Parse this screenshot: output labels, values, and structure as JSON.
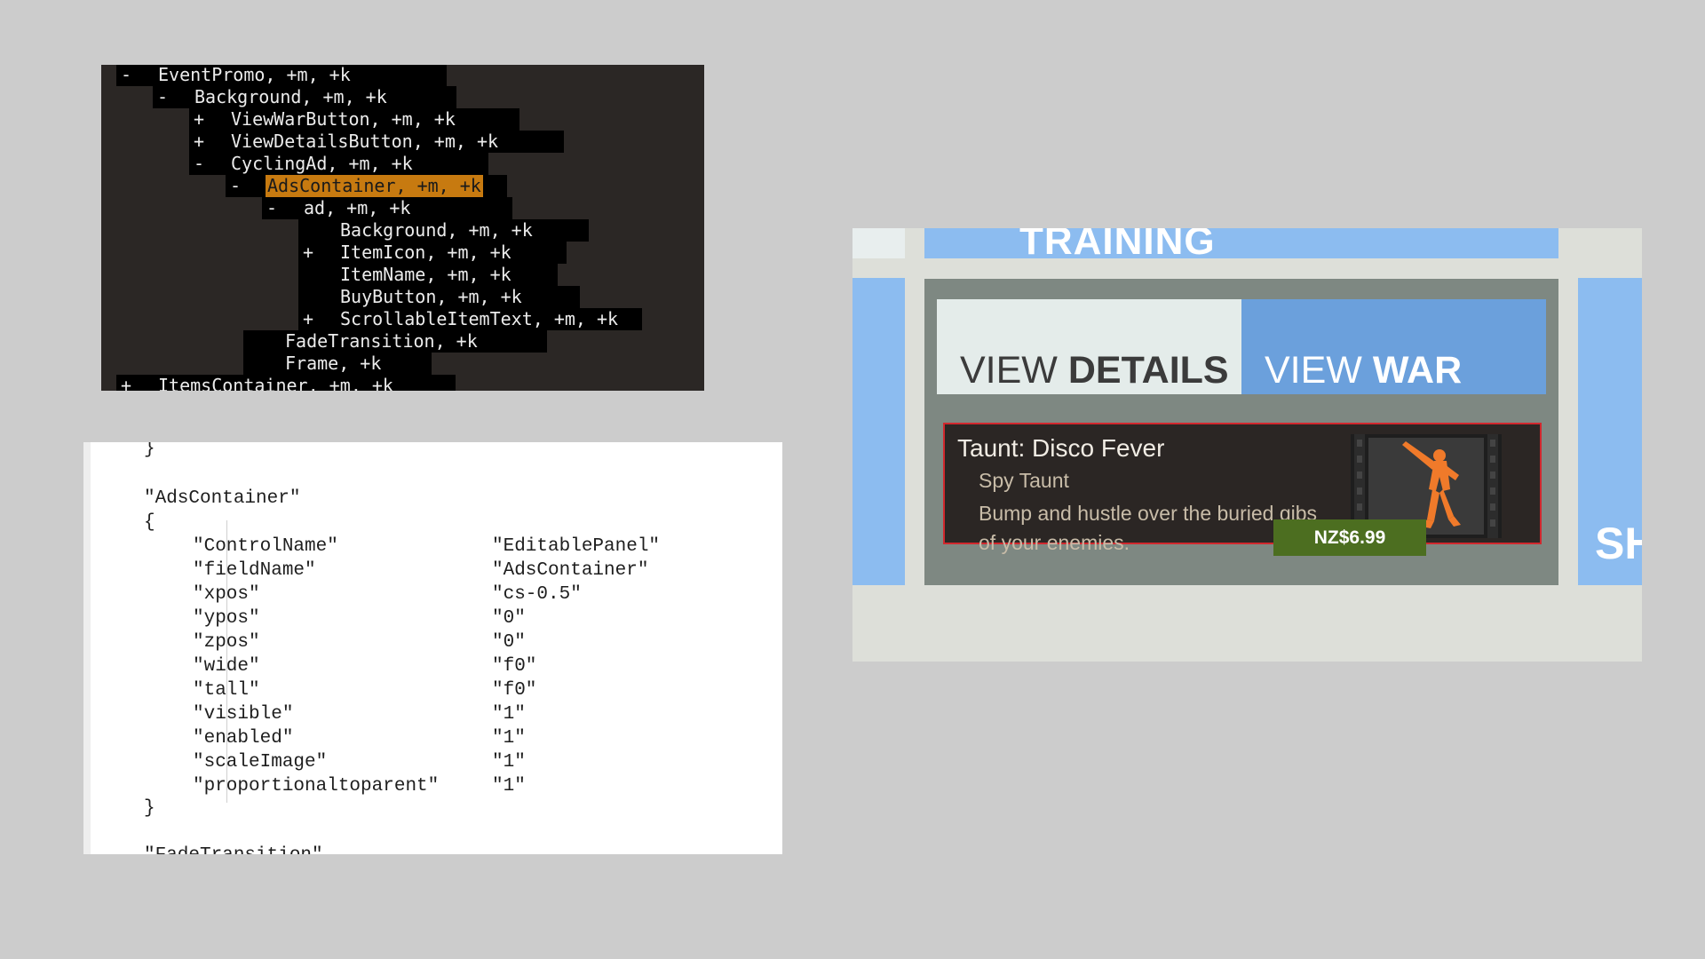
{
  "tree": {
    "rows": [
      {
        "sign": "-",
        "label": "EventPromo, +m, +k"
      },
      {
        "sign": "-",
        "label": "Background, +m, +k"
      },
      {
        "sign": "+",
        "label": "ViewWarButton, +m, +k"
      },
      {
        "sign": "+",
        "label": "ViewDetailsButton, +m, +k"
      },
      {
        "sign": "-",
        "label": "CyclingAd, +m, +k"
      },
      {
        "sign": "-",
        "label": "AdsContainer, +m, +k"
      },
      {
        "sign": "-",
        "label": "ad, +m, +k"
      },
      {
        "sign": "",
        "label": "Background, +m, +k"
      },
      {
        "sign": "+",
        "label": "ItemIcon, +m, +k"
      },
      {
        "sign": "",
        "label": "ItemName, +m, +k"
      },
      {
        "sign": "",
        "label": "BuyButton, +m, +k"
      },
      {
        "sign": "+",
        "label": "ScrollableItemText, +m, +k"
      },
      {
        "sign": "",
        "label": "FadeTransition, +k"
      },
      {
        "sign": "",
        "label": "Frame, +k"
      },
      {
        "sign": "+",
        "label": "ItemsContainer, +m, +k"
      }
    ]
  },
  "code": {
    "close_brace_top": "}",
    "block_name": "\"AdsContainer\"",
    "open_brace": "{",
    "properties": [
      {
        "key": "\"ControlName\"",
        "value": "\"EditablePanel\""
      },
      {
        "key": "\"fieldName\"",
        "value": "\"AdsContainer\""
      },
      {
        "key": "\"xpos\"",
        "value": "\"cs-0.5\""
      },
      {
        "key": "\"ypos\"",
        "value": "\"0\""
      },
      {
        "key": "\"zpos\"",
        "value": "\"0\""
      },
      {
        "key": "\"wide\"",
        "value": "\"f0\""
      },
      {
        "key": "\"tall\"",
        "value": "\"f0\""
      },
      {
        "key": "\"visible\"",
        "value": "\"1\""
      },
      {
        "key": "\"enabled\"",
        "value": "\"1\""
      },
      {
        "key": "\"scaleImage\"",
        "value": "\"1\""
      },
      {
        "key": "\"proportionaltoparent\"",
        "value": "\"1\""
      }
    ],
    "close_brace": "}",
    "next_block_name": "\"FadeTransition\""
  },
  "game": {
    "training_label": "TRAINING",
    "view_details": {
      "prefix": "VIEW ",
      "bold": "DETAILS"
    },
    "view_war": {
      "prefix": "VIEW ",
      "bold": "WAR"
    },
    "ad": {
      "item_name": "Taunt: Disco Fever",
      "item_type": "Spy Taunt",
      "description": "Bump and hustle over the buried gibs of your enemies.",
      "price": "NZ$6.99",
      "icon": "spy-disco-taunt-icon"
    },
    "side_label": "SH",
    "colors": {
      "highlight": "#c77a10",
      "panel_blue": "#8cbcf0",
      "war_blue": "#6ba0dc",
      "buy_green": "#4c6e20",
      "ad_border": "#d1282e"
    }
  }
}
